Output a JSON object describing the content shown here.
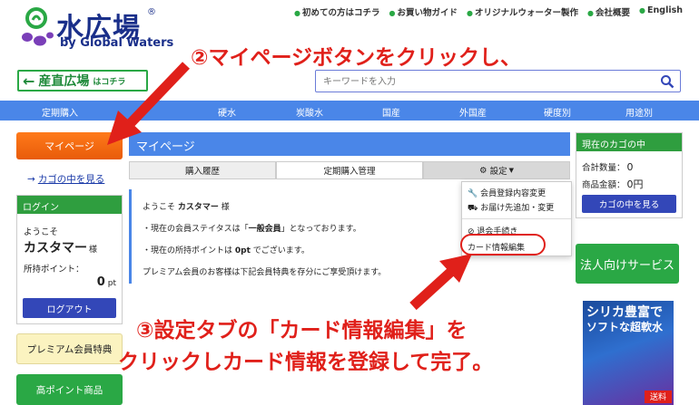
{
  "logo": {
    "title": "水広場",
    "reg": "®",
    "subtitle": "by Global Waters"
  },
  "toplinks": [
    "初めての方はコチラ",
    "お買い物ガイド",
    "オリジナルウォーター製作",
    "会社概要",
    "English"
  ],
  "sanchoku": {
    "label": "産直広場",
    "suffix": "はコチラ"
  },
  "search": {
    "placeholder": "キーワードを入力"
  },
  "nav": [
    "定期購入",
    "硬水",
    "炭酸水",
    "国産",
    "外国産",
    "硬度別",
    "用途別"
  ],
  "left": {
    "mypage": "マイページ",
    "cart_link": "カゴの中を見る",
    "login": {
      "title": "ログイン",
      "welcome": "ようこそ",
      "name": "カスタマー",
      "honorific": "様",
      "points_label": "所持ポイント：",
      "points_value": "0",
      "points_unit": "pt",
      "logout": "ログアウト"
    },
    "premium": "プレミアム会員特典",
    "high_points": "高ポイント商品"
  },
  "main": {
    "title": "マイページ",
    "tabs": [
      "購入履歴",
      "定期購入管理",
      "設定"
    ],
    "welcome_pre": "ようこそ",
    "welcome_name": "カスタマー",
    "welcome_suffix": "様",
    "line1_pre": "・現在の会員ステイタスは「",
    "line1_bold": "一般会員",
    "line1_post": "」となっております。",
    "line2_pre": "・現在の所持ポイントは",
    "line2_bold": "0pt",
    "line2_post": "でございます。",
    "line3": "プレミアム会員のお客様は下記会員特典を存分にご享受頂けます。"
  },
  "dropdown": [
    "会員登録内容変更",
    "お届け先追加・変更",
    "退会手続き",
    "カード情報編集"
  ],
  "right": {
    "cart_title": "現在のカゴの中",
    "total_qty_label": "合計数量：",
    "total_qty": "0",
    "total_price_label": "商品金額：",
    "total_price": "0円",
    "cart_button": "カゴの中を見る",
    "biz": "法人向けサービス",
    "promo_line1": "シリカ豊富で",
    "promo_line2": "ソフトな超軟水",
    "promo_badge": "送料"
  },
  "annotations": {
    "step2": "②マイページボタンをクリックし、",
    "step3_line1": "③設定タブの「カード情報編集」を",
    "step3_line2": "クリックしカード情報を登録して完了。"
  },
  "colors": {
    "accent_blue": "#4a86e8",
    "green": "#2aa845",
    "orange": "#f26a12",
    "annotation_red": "#e0201a",
    "button_navy": "#3347b8"
  }
}
